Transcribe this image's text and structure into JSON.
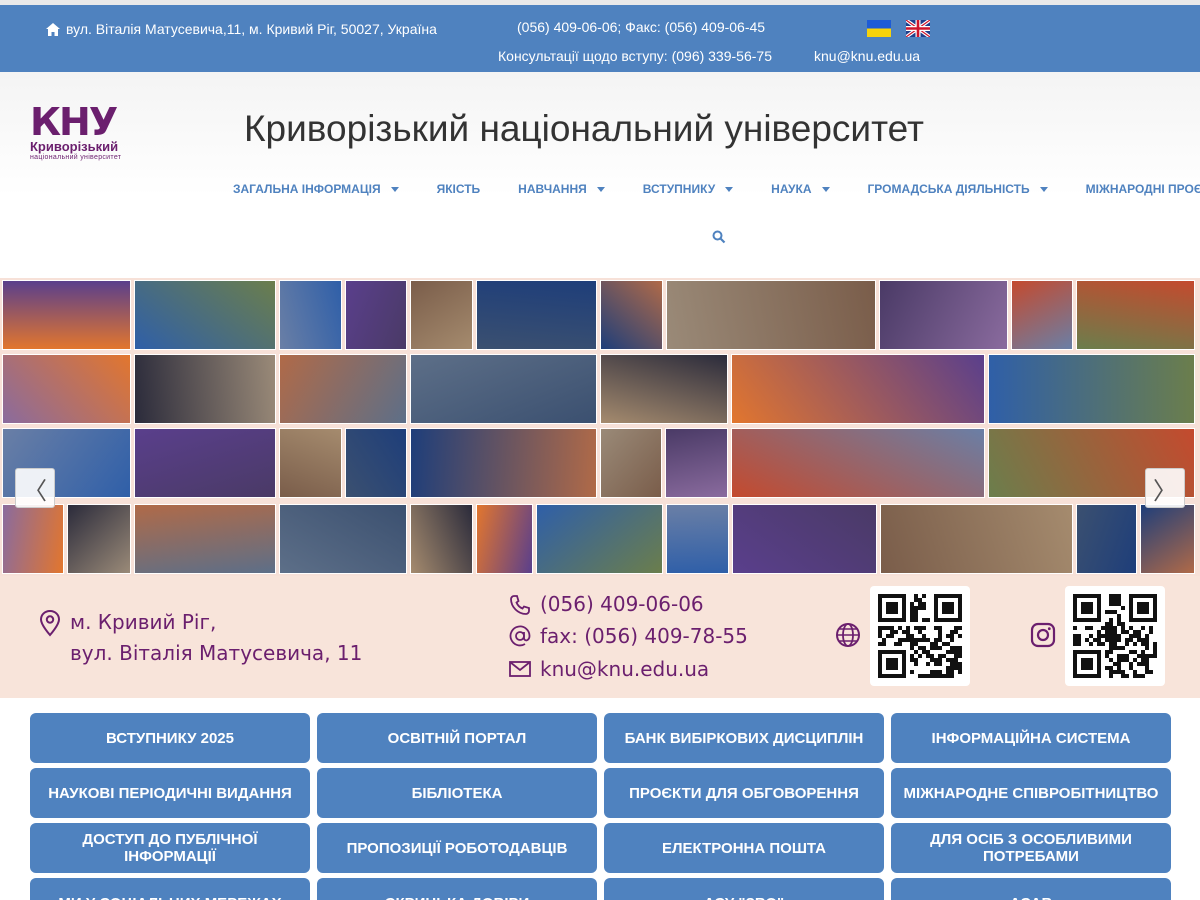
{
  "topbar": {
    "address": "вул. Віталія Матусевича,11, м. Кривий Ріг, 50027, Україна",
    "phone_fax": "(056) 409-06-06; Факс: (056) 409-06-45",
    "consult": "Консультації щодо вступу: (096) 339-56-75",
    "email": "knu@knu.edu.ua",
    "icons": [
      "home-icon",
      "flag-ua-icon",
      "flag-uk-icon"
    ],
    "background": "#4f82bf"
  },
  "header": {
    "logo_big": "КНУ",
    "logo_line1": "Криворізький",
    "logo_line2": "національний університет",
    "title": "Криворізький національний університет"
  },
  "nav": {
    "items": [
      {
        "label": "Загальна інформація",
        "dropdown": true
      },
      {
        "label": "Якість",
        "dropdown": false
      },
      {
        "label": "Навчання",
        "dropdown": true
      },
      {
        "label": "Вступнику",
        "dropdown": true
      },
      {
        "label": "Наука",
        "dropdown": true
      },
      {
        "label": "Громадська діяльність",
        "dropdown": true
      },
      {
        "label": "Міжнародні проєкти",
        "dropdown": false
      }
    ],
    "search_icon": "search-icon"
  },
  "slider": {
    "prev": "〈",
    "next": "〉"
  },
  "contacts": {
    "city": "м. Кривий Ріг,",
    "street": "вул. Віталія Матусевича, 11",
    "phone": "(056) 409-06-06",
    "fax": "fax: (056) 409-78-55",
    "email": "knu@knu.edu.ua",
    "accent": "#6b1f6e"
  },
  "buttons": [
    "ВСТУПНИКУ 2025",
    "ОСВІТНІЙ ПОРТАЛ",
    "БАНК ВИБІРКОВИХ ДИСЦИПЛІН",
    "ІНФОРМАЦІЙНА СИСТЕМА",
    "НАУКОВІ ПЕРІОДИЧНІ ВИДАННЯ",
    "БІБЛІОТЕКА",
    "ПРОЄКТИ ДЛЯ ОБГОВОРЕННЯ",
    "МІЖНАРОДНЕ СПІВРОБІТНИЦТВО",
    "ДОСТУП ДО ПУБЛІЧНОЇ ІНФОРМАЦІЇ",
    "ПРОПОЗИЦІЇ РОБОТОДАВЦІВ",
    "ЕЛЕКТРОННА ПОШТА",
    "ДЛЯ ОСІБ З ОСОБЛИВИМИ ПОТРЕБАМИ",
    "МИ У СОЦІАЛЬНИХ МЕРЕЖАХ",
    "СКРИНЬКА ДОВІРИ",
    "АСУ \"ЗВО\"",
    "АСАВ"
  ]
}
